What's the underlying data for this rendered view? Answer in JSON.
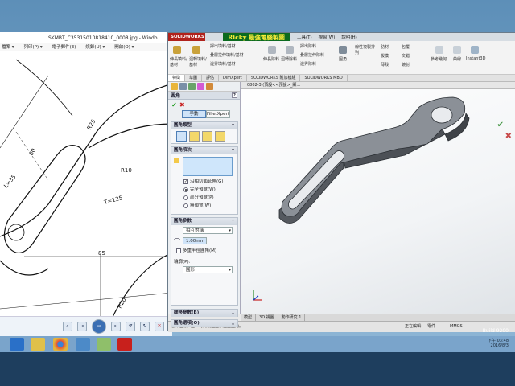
{
  "photo_viewer": {
    "title": "SKMBT_C35315010818410_0008.jpg - Windo",
    "menu": [
      "檔案 ▾",
      "列印(P) ▾",
      "電子郵件(E)",
      "燒錄(U) ▾",
      "開啟(O) ▾"
    ],
    "drawing_labels": {
      "r25": "R25",
      "d60": "60",
      "r10": "R10",
      "l35": "L=35",
      "t125": "T=125",
      "d85": "85",
      "r20": "R20"
    },
    "controls": [
      "search-icon",
      "prev-icon",
      "play-icon",
      "next-icon",
      "rotate-left-icon",
      "rotate-right-icon",
      "delete-icon"
    ]
  },
  "solidworks": {
    "logo": "SOLIDWORKS",
    "brand": "Ricky 最強電腦製圖",
    "menus": [
      "工具(T)",
      "視窗(W)",
      "說明(H)"
    ],
    "ribbon": {
      "left_buttons": [
        "伸長填料/基材",
        "迴轉填料/基材"
      ],
      "col1": [
        "掃出填料/基材",
        "疊層拉伸填料/基材",
        "邊界填料/基材"
      ],
      "mid_buttons": [
        "伸長除料",
        "迴轉除料"
      ],
      "col2": [
        "掃出除料",
        "疊層拉伸除料",
        "邊界除料"
      ],
      "right": [
        "圓角",
        "線性複製排列",
        "肋材",
        "拔模",
        "包覆",
        "薄殼",
        "交錯",
        "鏡射",
        "參考幾何",
        "曲線",
        "Instant3D"
      ]
    },
    "tabs": [
      "特徵",
      "草圖",
      "評估",
      "DimXpert",
      "SOLIDWORKS 附加模組",
      "SOLIDWORKS MBD"
    ],
    "breadcrumb": "0802-3 (預設<<預設>_顯...",
    "bottom_tabs": [
      "模型",
      "3D 視圖",
      "動作研究 1"
    ],
    "status": {
      "hint": "選擇邊線、面、特徵或迴圈來產生圓角。",
      "editing": "正在編輯：",
      "part": "零件",
      "unit": "MMGS"
    }
  },
  "property_manager": {
    "title": "圓角",
    "manual": "手動",
    "filletxpert": "FilletXpert",
    "sections": {
      "type": "圓角類型",
      "items": "圓角項次",
      "params": "圓角參數",
      "setback": "緩移參數(B)",
      "options": "圓角選項(O)"
    },
    "tangent_propagation": "沿相切面延伸(G)",
    "preview_full": "完全預覽(W)",
    "preview_partial": "部分預覽(P)",
    "preview_none": "無預覽(W)",
    "param_type": "相互對稱",
    "radius_value": "1.00mm",
    "multi_radius": "多重半徑圓角(M)",
    "profile_label": "輪廓(P):",
    "profile_value": "圓形"
  },
  "taskbar": {
    "icons": [
      "ie-icon",
      "file-explorer-icon",
      "chrome-icon",
      "network-icon",
      "folder-icon",
      "solidworks-icon"
    ],
    "time": "下午 03:48",
    "date": "2016/8/3",
    "build": "Build 9200"
  }
}
